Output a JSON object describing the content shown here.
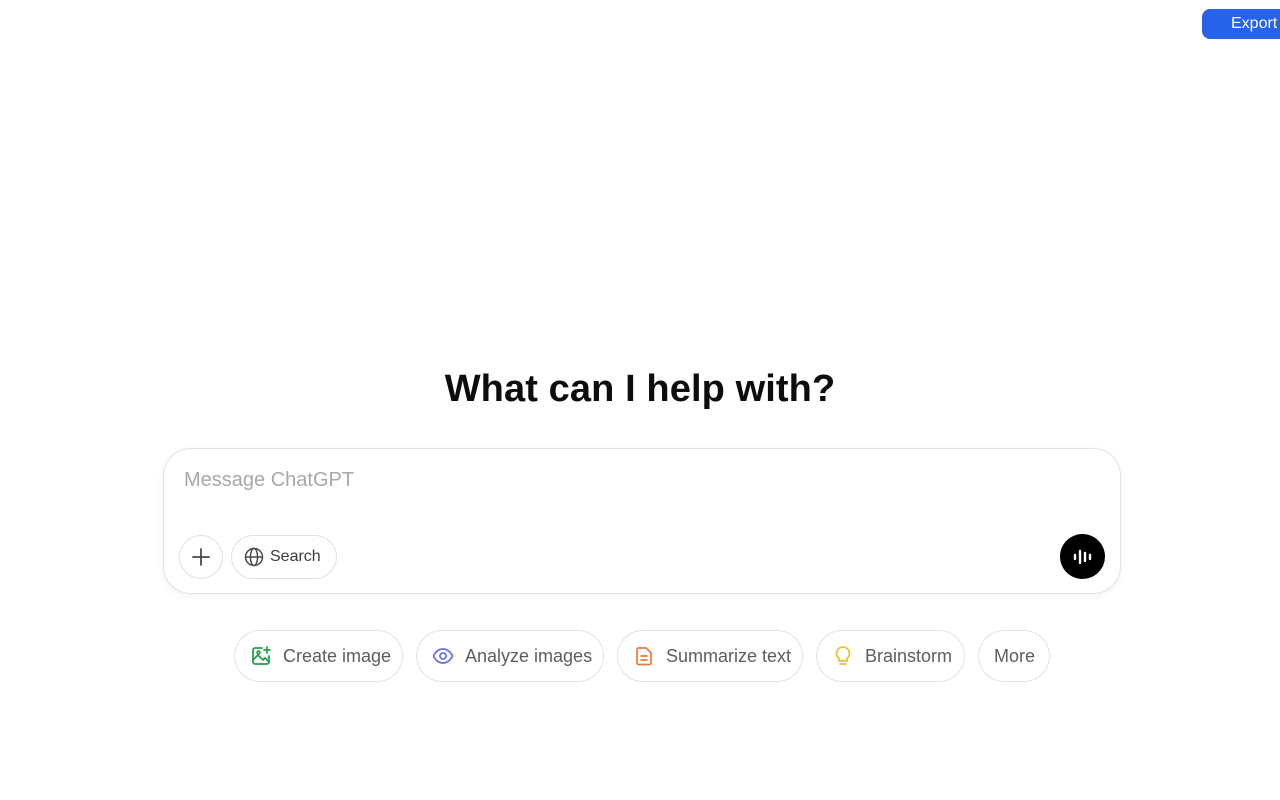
{
  "toolbar": {
    "export_label": "Export"
  },
  "main": {
    "heading": "What can I help with?"
  },
  "composer": {
    "placeholder": "Message ChatGPT",
    "value": "",
    "search_label": "Search",
    "icons": {
      "attach": "plus-icon",
      "search": "globe-icon",
      "voice": "voice-waveform-icon"
    }
  },
  "suggestions": [
    {
      "label": "Create image",
      "icon": "image-sparkle-icon",
      "color": "#1fa046"
    },
    {
      "label": "Analyze images",
      "icon": "eye-icon",
      "color": "#6b72e8"
    },
    {
      "label": "Summarize text",
      "icon": "document-icon",
      "color": "#ea7a3c"
    },
    {
      "label": "Brainstorm",
      "icon": "lightbulb-icon",
      "color": "#e2c534"
    },
    {
      "label": "More"
    }
  ],
  "colors": {
    "accent": "#2563eb",
    "voice_button": "#000000"
  }
}
